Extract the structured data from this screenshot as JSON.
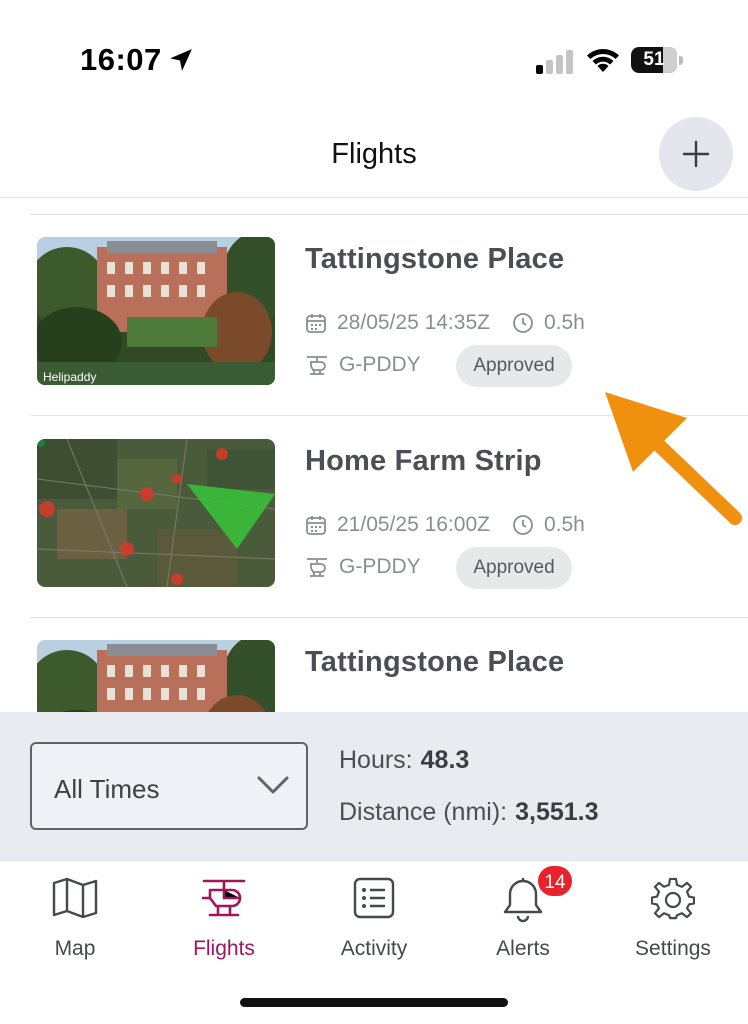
{
  "status_bar": {
    "time": "16:07",
    "battery": "51"
  },
  "header": {
    "title": "Flights",
    "add_label": "+"
  },
  "flights": [
    {
      "title": "Tattingstone Place",
      "date": "28/05/25 14:35Z",
      "duration": "0.5h",
      "aircraft": "G-PDDY",
      "status": "Approved",
      "thumb_watermark": "Helipaddy"
    },
    {
      "title": "Home Farm Strip",
      "date": "21/05/25 16:00Z",
      "duration": "0.5h",
      "aircraft": "G-PDDY",
      "status": "Approved"
    },
    {
      "title": "Tattingstone Place"
    }
  ],
  "summary": {
    "period": "All Times",
    "hours_label": "Hours:",
    "hours_value": "48.3",
    "distance_label": "Distance (nmi):",
    "distance_value": "3,551.3"
  },
  "tabs": [
    {
      "label": "Map",
      "icon": "map-icon"
    },
    {
      "label": "Flights",
      "icon": "helicopter-icon",
      "active": true
    },
    {
      "label": "Activity",
      "icon": "list-icon"
    },
    {
      "label": "Alerts",
      "icon": "bell-icon",
      "badge": "14"
    },
    {
      "label": "Settings",
      "icon": "gear-icon"
    }
  ],
  "colors": {
    "accent": "#a1155a",
    "badge_red": "#e8232b",
    "annotation_arrow": "#f0900f"
  }
}
